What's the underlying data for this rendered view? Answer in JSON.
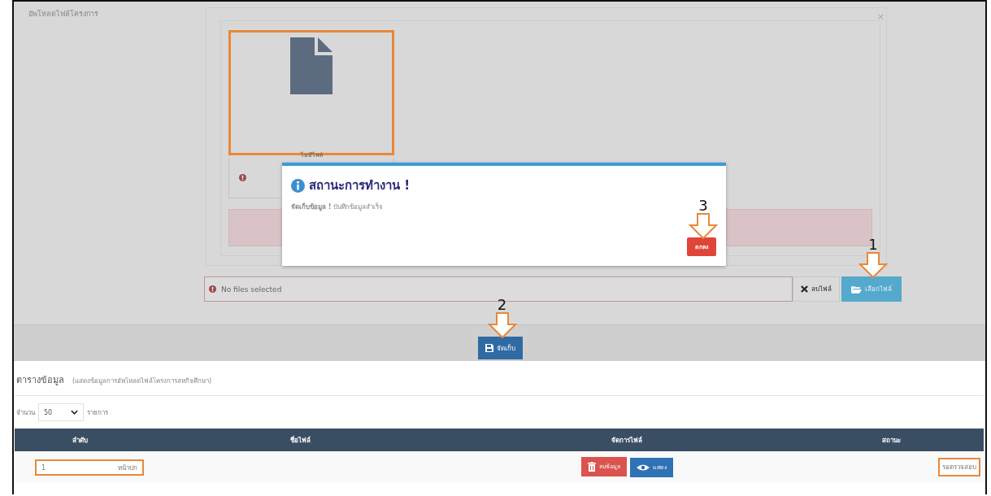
{
  "upload": {
    "label": "อัพโหลดไฟล์โครงการ",
    "close": "×",
    "thumbnail": {
      "caption": "ไม่มีไฟล์"
    },
    "file_field": {
      "placeholder": "No files selected"
    },
    "remove_button": "ลบไฟล์",
    "browse_button": "เลือกไฟล์",
    "save_button": "จัดเก็บ"
  },
  "dialog": {
    "title": "สถานะการทำงาน !",
    "message": "**จัดเก็บข้อมูล !** บันทึกข้อมูลสำเร็จ",
    "ok_button": "ตกลง"
  },
  "annotations": [
    {
      "number": "1"
    },
    {
      "number": "2"
    },
    {
      "number": "3"
    }
  ],
  "table": {
    "title": "ตารางข้อมูล",
    "subtitle": "(แสดงข้อมูลการอัพโหลดไฟล์โครงการสหกิจศึกษา)",
    "page_size": {
      "prefix": "จำนวน",
      "value": "50",
      "suffix": "รายการ"
    },
    "columns": [
      "ลำดับ",
      "ชื่อไฟล์",
      "จัดการไฟล์",
      "สถานะ"
    ],
    "rows": [
      {
        "order": "1",
        "order_unit": "หน้าปก",
        "actions": [
          "ลบข้อมูล",
          "แสดง"
        ],
        "status": "รอตรวจสอบ"
      }
    ]
  }
}
